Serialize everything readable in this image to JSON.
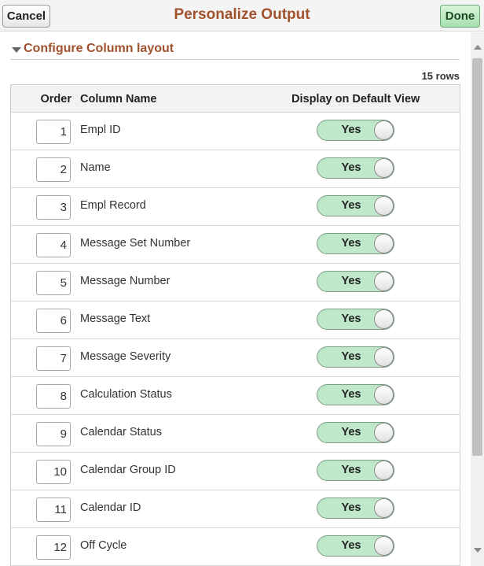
{
  "header": {
    "title": "Personalize Output",
    "cancel_label": "Cancel",
    "done_label": "Done"
  },
  "section": {
    "title": "Configure Column layout",
    "row_count": "15 rows"
  },
  "grid": {
    "columns": [
      "Order",
      "Column Name",
      "Display on Default View"
    ],
    "rows": [
      {
        "order": "1",
        "name": "Empl ID",
        "display": "Yes"
      },
      {
        "order": "2",
        "name": "Name",
        "display": "Yes"
      },
      {
        "order": "3",
        "name": "Empl Record",
        "display": "Yes"
      },
      {
        "order": "4",
        "name": "Message Set Number",
        "display": "Yes"
      },
      {
        "order": "5",
        "name": "Message Number",
        "display": "Yes"
      },
      {
        "order": "6",
        "name": "Message Text",
        "display": "Yes"
      },
      {
        "order": "7",
        "name": "Message Severity",
        "display": "Yes"
      },
      {
        "order": "8",
        "name": "Calculation Status",
        "display": "Yes"
      },
      {
        "order": "9",
        "name": "Calendar Status",
        "display": "Yes"
      },
      {
        "order": "10",
        "name": "Calendar Group ID",
        "display": "Yes"
      },
      {
        "order": "11",
        "name": "Calendar ID",
        "display": "Yes"
      },
      {
        "order": "12",
        "name": "Off Cycle",
        "display": "Yes"
      }
    ]
  },
  "colors": {
    "title": "#a0522d",
    "toggle_on": "#bfe8cb",
    "done_button": "#a6e0ad"
  }
}
